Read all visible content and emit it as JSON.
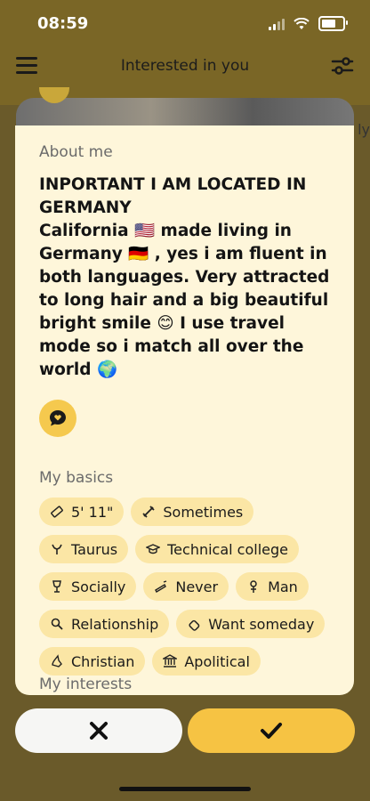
{
  "status": {
    "time": "08:59"
  },
  "nav": {
    "title": "Interested in you"
  },
  "peek": {
    "side_text": "ly"
  },
  "about": {
    "title": "About me",
    "text": "INPORTANT I AM LOCATED IN GERMANY\nCalifornia 🇺🇸 made living in Germany 🇩🇪 , yes i am fluent in both languages. Very attracted to long hair and a big beautiful bright smile 😊 I use travel mode so i match all over the world 🌍"
  },
  "basics": {
    "title": "My basics",
    "chips": [
      {
        "label": "5' 11\"",
        "icon": "ruler-icon"
      },
      {
        "label": "Sometimes",
        "icon": "dumbbell-icon"
      },
      {
        "label": "Taurus",
        "icon": "zodiac-icon"
      },
      {
        "label": "Technical college",
        "icon": "graduation-cap-icon"
      },
      {
        "label": "Socially",
        "icon": "wine-glass-icon"
      },
      {
        "label": "Never",
        "icon": "smoking-icon"
      },
      {
        "label": "Man",
        "icon": "gender-icon"
      },
      {
        "label": "Relationship",
        "icon": "search-icon"
      },
      {
        "label": "Want someday",
        "icon": "baby-bottle-icon"
      },
      {
        "label": "Christian",
        "icon": "praying-hands-icon"
      },
      {
        "label": "Apolitical",
        "icon": "government-icon"
      }
    ]
  },
  "interests": {
    "title": "My interests"
  },
  "colors": {
    "card": "#fef6da",
    "chip": "#fbe6a5",
    "accent": "#f6c343"
  }
}
